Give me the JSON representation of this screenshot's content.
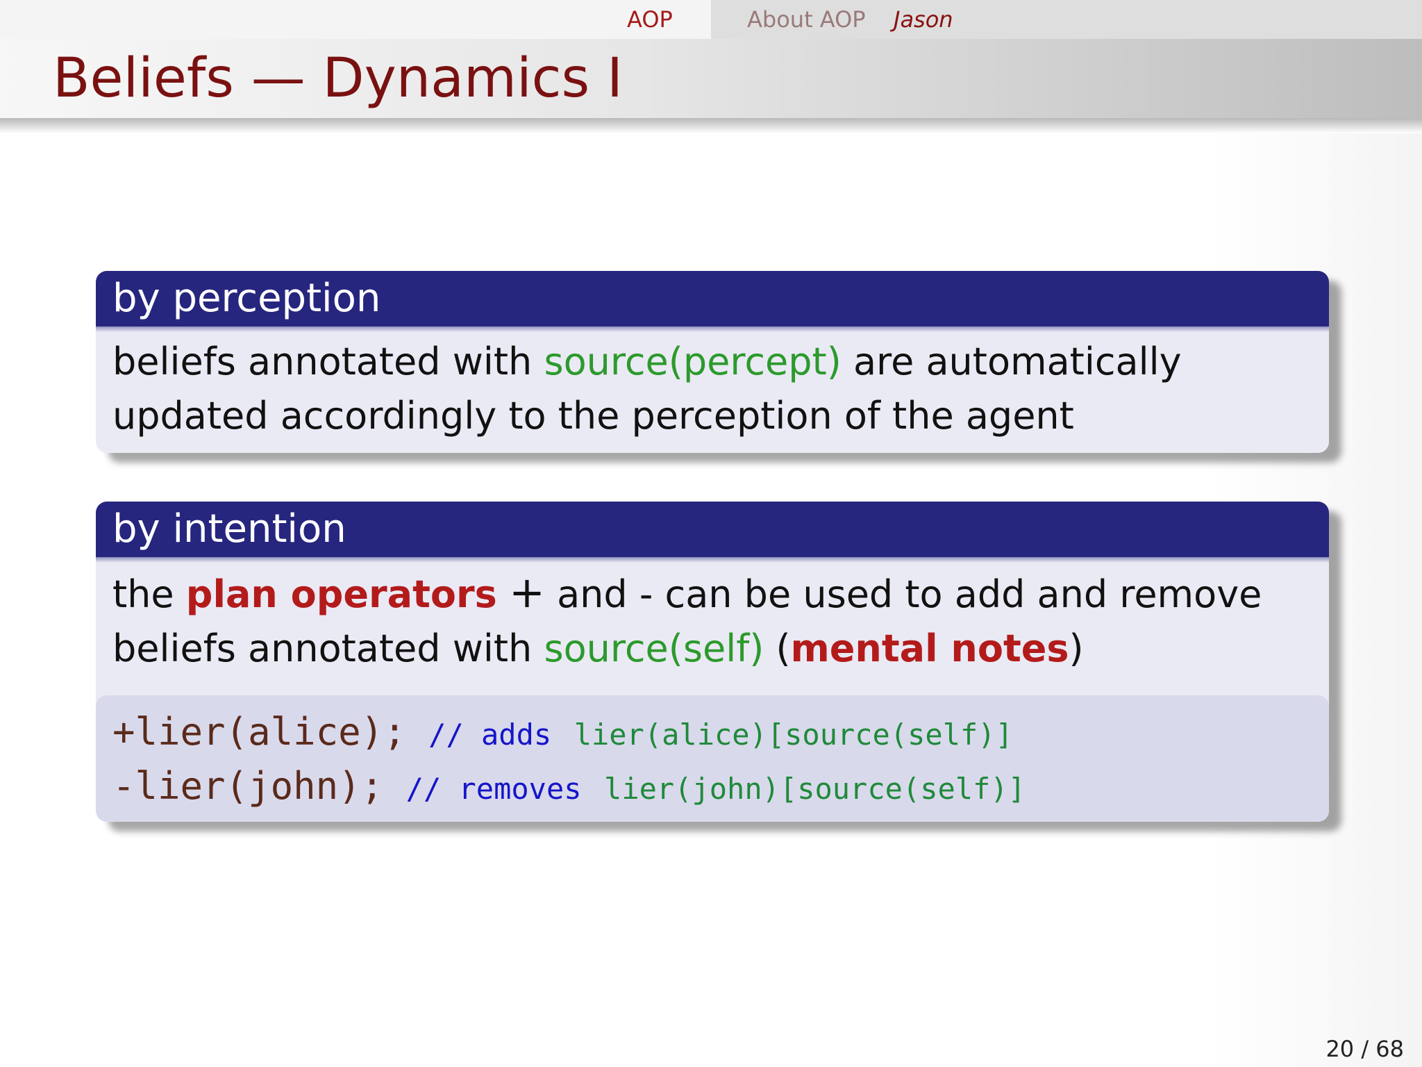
{
  "nav": {
    "section": "AOP",
    "subsection": "About AOP",
    "subsubsection": "Jason"
  },
  "slide": {
    "title": "Beliefs — Dynamics I",
    "page": "20 / 68"
  },
  "block_perception": {
    "title": "by perception",
    "text_1": "beliefs annotated with ",
    "term_1": "source(percept)",
    "text_2": " are automatically updated accordingly to the perception of the agent"
  },
  "block_intention": {
    "title": "by intention",
    "text_1": "the ",
    "emph_1": "plan operators",
    "op_plus": "+",
    "text_2": " and ",
    "op_minus": "-",
    "text_3": " can be used to add and remove beliefs annotated with ",
    "term_1": "source(self)",
    "text_4": " (",
    "emph_2": "mental notes",
    "text_5": ")",
    "code": [
      {
        "stmt": "+lier(alice);",
        "comment": "// adds",
        "term": "lier(alice)[source(self)]"
      },
      {
        "stmt": "-lier(john);",
        "comment": "// removes",
        "term": "lier(john)[source(self)]"
      }
    ]
  },
  "colors": {
    "title_text": "#7a1111",
    "block_header": "#26267f",
    "block_body": "#eaeaf4",
    "code_bg": "#d9d9ec",
    "green_term": "#2c9a2c",
    "red_emphasis": "#b31b1b",
    "code_comment": "#1515c8"
  }
}
